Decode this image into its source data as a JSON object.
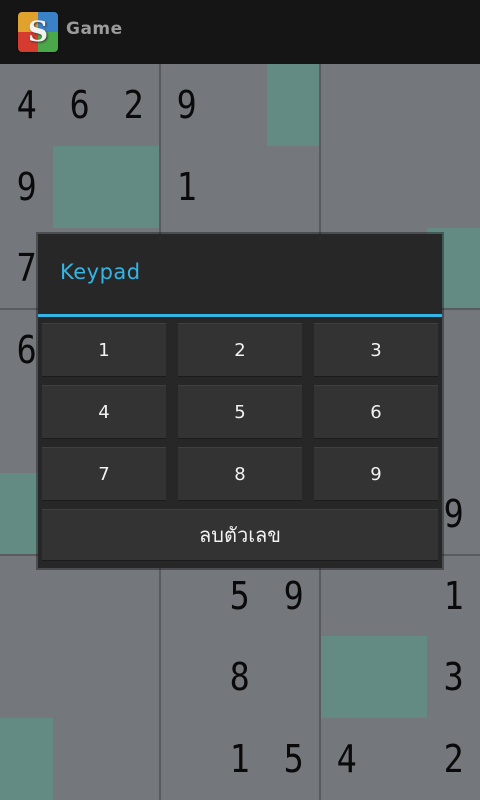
{
  "app": {
    "title": "Game",
    "icon_letter": "S",
    "icon_colors": [
      "#e1a12d",
      "#3a82c8",
      "#d63b2f",
      "#4aa84a"
    ]
  },
  "board": {
    "highlight_color": "#5d9286",
    "rows": [
      [
        "4",
        "6",
        "2",
        "9",
        "",
        "",
        "",
        "",
        ""
      ],
      [
        "9",
        "",
        "",
        "1",
        "",
        "",
        "",
        "",
        ""
      ],
      [
        "7",
        "",
        "",
        "",
        "",
        "",
        "",
        "",
        ""
      ],
      [
        "6",
        "",
        "",
        "",
        "",
        "",
        "",
        "",
        ""
      ],
      [
        "",
        "",
        "",
        "",
        "",
        "",
        "",
        "",
        ""
      ],
      [
        "",
        "",
        "",
        "",
        "",
        "",
        "",
        "",
        "9"
      ],
      [
        "",
        "",
        "",
        "",
        "5",
        "9",
        "",
        "",
        "1"
      ],
      [
        "",
        "",
        "",
        "",
        "8",
        "",
        "",
        "",
        "3"
      ],
      [
        "",
        "",
        "",
        "",
        "1",
        "5",
        "4",
        "",
        "2"
      ]
    ],
    "highlighted_cells": [
      [
        0,
        5
      ],
      [
        1,
        1
      ],
      [
        1,
        2
      ],
      [
        2,
        8
      ],
      [
        5,
        0
      ],
      [
        7,
        6
      ],
      [
        7,
        7
      ],
      [
        8,
        0
      ]
    ]
  },
  "keypad": {
    "title": "Keypad",
    "accent_color": "#33b5e5",
    "keys": [
      "1",
      "2",
      "3",
      "4",
      "5",
      "6",
      "7",
      "8",
      "9"
    ],
    "clear_label": "ลบตัวเลข"
  }
}
